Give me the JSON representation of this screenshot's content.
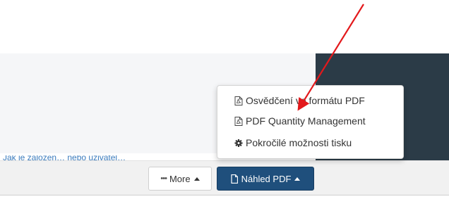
{
  "dropdown": {
    "items": [
      {
        "label": "Osvědčení ve formátu PDF",
        "icon": "pdf-file-icon"
      },
      {
        "label": "PDF Quantity Management",
        "icon": "pdf-file-icon"
      },
      {
        "label": "Pokročilé možnosti tisku",
        "icon": "gear-icon"
      }
    ]
  },
  "footer": {
    "more_label": "More",
    "pdf_label": "Náhled PDF"
  },
  "background": {
    "cut_text": "Jak je založen…  nebo uživatel…"
  },
  "colors": {
    "dark_panel": "#2b3b47",
    "primary_button": "#1f4f7c",
    "arrow": "#e3191c"
  }
}
